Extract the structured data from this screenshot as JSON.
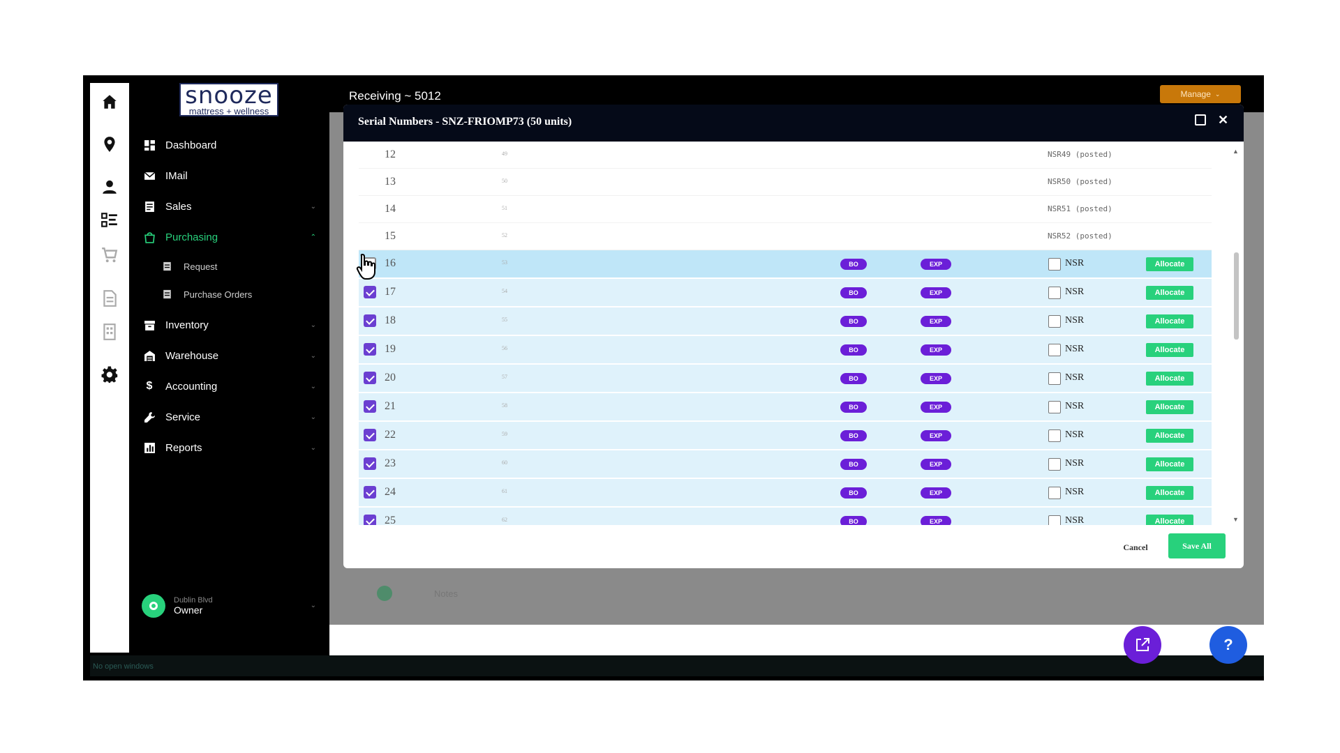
{
  "app": {
    "logo_word": "snooze",
    "logo_tagline": "mattress + wellness",
    "page_title": "Receiving ~ 5012",
    "manage_label": "Manage",
    "status_bar_text": "No open windows"
  },
  "rail": {
    "icons": [
      "home-icon",
      "location-pin-icon",
      "user-icon",
      "checklist-icon",
      "cart-icon",
      "document-icon",
      "building-icon",
      "gear-icon"
    ]
  },
  "sidebar": {
    "items": [
      {
        "label": "Dashboard",
        "icon": "dashboard-icon"
      },
      {
        "label": "IMail",
        "icon": "mail-icon"
      },
      {
        "label": "Sales",
        "icon": "sales-icon"
      },
      {
        "label": "Purchasing",
        "icon": "shopping-bag-icon"
      },
      {
        "label": "Inventory",
        "icon": "inventory-icon"
      },
      {
        "label": "Warehouse",
        "icon": "warehouse-icon"
      },
      {
        "label": "Accounting",
        "icon": "dollar-icon"
      },
      {
        "label": "Service",
        "icon": "wrench-icon"
      },
      {
        "label": "Reports",
        "icon": "reports-icon"
      }
    ],
    "sub_items": [
      {
        "label": "Request"
      },
      {
        "label": "Purchase Orders"
      }
    ],
    "user": {
      "location": "Dublin Blvd",
      "role": "Owner"
    }
  },
  "modal": {
    "title": "Serial Numbers - SNZ-FRIOMP73 (50 units)",
    "cancel_label": "Cancel",
    "save_label": "Save All",
    "bo_label": "BO",
    "exp_label": "EXP",
    "nsr_label": "NSR",
    "allocate_label": "Allocate",
    "posted_rows": [
      {
        "num": "12",
        "sub": "49",
        "serial": "NSR49 (posted)"
      },
      {
        "num": "13",
        "sub": "50",
        "serial": "NSR50 (posted)"
      },
      {
        "num": "14",
        "sub": "51",
        "serial": "NSR51 (posted)"
      },
      {
        "num": "15",
        "sub": "52",
        "serial": "NSR52 (posted)"
      }
    ],
    "open_rows": [
      {
        "num": "16",
        "sub": "53",
        "checked": false
      },
      {
        "num": "17",
        "sub": "54",
        "checked": true
      },
      {
        "num": "18",
        "sub": "55",
        "checked": true
      },
      {
        "num": "19",
        "sub": "56",
        "checked": true
      },
      {
        "num": "20",
        "sub": "57",
        "checked": true
      },
      {
        "num": "21",
        "sub": "58",
        "checked": true
      },
      {
        "num": "22",
        "sub": "59",
        "checked": true
      },
      {
        "num": "23",
        "sub": "60",
        "checked": true
      },
      {
        "num": "24",
        "sub": "61",
        "checked": true
      },
      {
        "num": "25",
        "sub": "62",
        "checked": true
      }
    ]
  },
  "background": {
    "row_text": "Notes"
  },
  "colors": {
    "accent_green": "#28d17c",
    "pill_purple": "#6b1fd8",
    "selected_row": "#dff2fb",
    "header_navy": "#050a18",
    "manage_orange": "#c8780a"
  }
}
